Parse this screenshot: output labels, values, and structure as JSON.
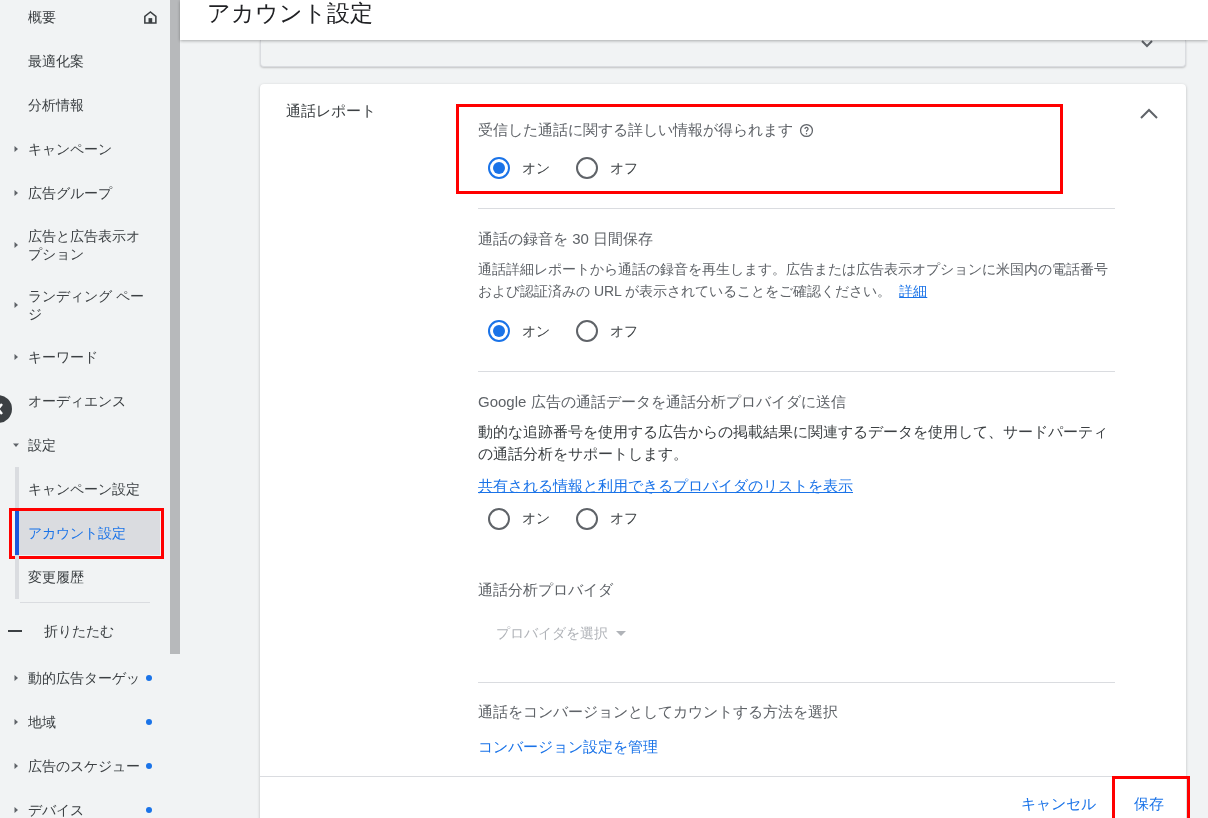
{
  "sidebar": {
    "items": [
      {
        "label": "概要",
        "home": true
      },
      {
        "label": "最適化案"
      },
      {
        "label": "分析情報"
      },
      {
        "label": "キャンペーン",
        "expanded": false
      },
      {
        "label": "広告グループ",
        "expanded": false
      },
      {
        "label": "広告と広告表示オプション",
        "expanded": false
      },
      {
        "label": "ランディング ページ",
        "expanded": false
      },
      {
        "label": "キーワード",
        "expanded": false
      },
      {
        "label": "オーディエンス"
      },
      {
        "label": "設定",
        "expanded": true,
        "children": [
          {
            "label": "キャンペーン設定",
            "selected": false,
            "highlighted": false
          },
          {
            "label": "アカウント設定",
            "selected": true,
            "highlighted": true
          },
          {
            "label": "変更履歴",
            "selected": false,
            "highlighted": false
          }
        ]
      }
    ],
    "collapse": "折りたたむ",
    "more_items": [
      {
        "label": "動的広告ターゲッ",
        "expanded": false,
        "color": "#1a73e8"
      },
      {
        "label": "地域",
        "expanded": false,
        "color": "#1a73e8"
      },
      {
        "label": "広告のスケジュー",
        "expanded": false,
        "color": "#1a73e8"
      },
      {
        "label": "デバイス",
        "expanded": false,
        "color": "#1a73e8"
      }
    ]
  },
  "header": {
    "title": "アカウント設定"
  },
  "card": {
    "title": "通話レポート",
    "expanded": true,
    "sections": [
      {
        "kind": "radio",
        "title": "受信した通話に関する詳しい情報が得られます",
        "help": true,
        "highlighted": true,
        "options": [
          {
            "label": "オン",
            "selected": true
          },
          {
            "label": "オフ",
            "selected": false
          }
        ]
      },
      {
        "kind": "radio",
        "title": "通話の録音を 30 日間保存",
        "description": "通話詳細レポートから通話の録音を再生します。広告または広告表示オプションに米国内の電話番号および認証済みの URL が表示されていることをご確認ください。",
        "inline_link": "詳細",
        "highlighted": false,
        "options": [
          {
            "label": "オン",
            "selected": true
          },
          {
            "label": "オフ",
            "selected": false
          }
        ]
      },
      {
        "kind": "radio",
        "title": "Google 広告の通話データを通話分析プロバイダに送信",
        "description": "動的な追跡番号を使用する広告からの掲載結果に関連するデータを使用して、サードパーティの通話分析をサポートします。",
        "link": "共有される情報と利用できるプロバイダのリストを表示",
        "highlighted": false,
        "options": [
          {
            "label": "オン",
            "selected": false
          },
          {
            "label": "オフ",
            "selected": false
          }
        ]
      },
      {
        "kind": "select",
        "title": "通話分析プロバイダ",
        "placeholder": "プロバイダを選択",
        "disabled": true
      },
      {
        "kind": "link",
        "title": "通話をコンバージョンとしてカウントする方法を選択",
        "link": "コンバージョン設定を管理"
      }
    ],
    "buttons": [
      {
        "label": "キャンセル",
        "highlighted": false
      },
      {
        "label": "保存",
        "highlighted": true
      }
    ]
  }
}
